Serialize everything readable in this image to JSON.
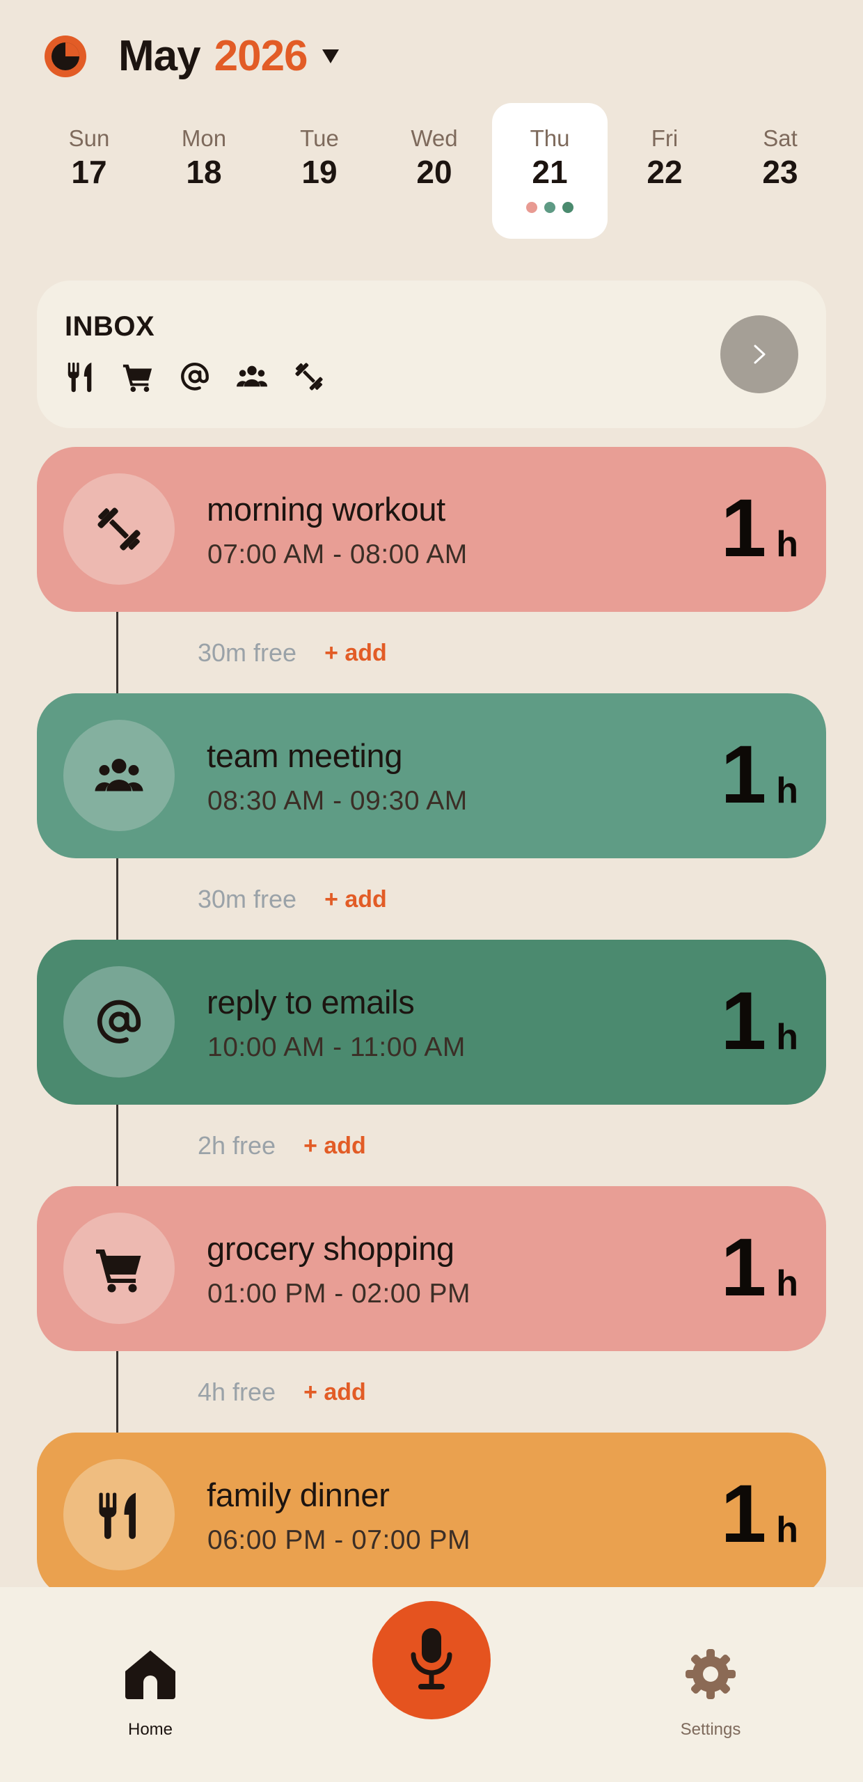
{
  "header": {
    "logo_icon": "pie-clock-logo",
    "month": "May",
    "year": "2026",
    "month_picker_icon": "caret-down-icon"
  },
  "week": [
    {
      "name": "Sun",
      "num": "17",
      "selected": false
    },
    {
      "name": "Mon",
      "num": "18",
      "selected": false
    },
    {
      "name": "Tue",
      "num": "19",
      "selected": false
    },
    {
      "name": "Wed",
      "num": "20",
      "selected": false
    },
    {
      "name": "Thu",
      "num": "21",
      "selected": true,
      "dot_colors": [
        "#e89a92",
        "#5e9a84",
        "#4a8a6e"
      ]
    },
    {
      "name": "Fri",
      "num": "22",
      "selected": false
    },
    {
      "name": "Sat",
      "num": "23",
      "selected": false
    }
  ],
  "inbox": {
    "title": "INBOX",
    "icons": [
      "fork-knife-icon",
      "cart-icon",
      "at-icon",
      "people-icon",
      "dumbbell-icon"
    ],
    "open_icon": "chevron-right-icon"
  },
  "events": [
    {
      "title": "morning workout",
      "time": "07:00 AM - 08:00 AM",
      "duration": "1",
      "unit": "h",
      "icon": "dumbbell-icon",
      "color": "#e89e95",
      "circle": "#edb9b1"
    },
    {
      "title": "team meeting",
      "time": "08:30 AM - 09:30 AM",
      "duration": "1",
      "unit": "h",
      "icon": "people-icon",
      "color": "#5f9c85",
      "circle": "#84b09f"
    },
    {
      "title": "reply to emails",
      "time": "10:00 AM - 11:00 AM",
      "duration": "1",
      "unit": "h",
      "icon": "at-icon",
      "color": "#4b8a6f",
      "circle": "#78a695"
    },
    {
      "title": "grocery shopping",
      "time": "01:00 PM - 02:00 PM",
      "duration": "1",
      "unit": "h",
      "icon": "cart-icon",
      "color": "#e89e95",
      "circle": "#edb9b1"
    },
    {
      "title": "family dinner",
      "time": "06:00 PM - 07:00 PM",
      "duration": "1",
      "unit": "h",
      "icon": "fork-knife-icon",
      "color": "#eaa14f",
      "circle": "#efbd80"
    }
  ],
  "gaps": [
    {
      "free": "30m free",
      "add": "+ add"
    },
    {
      "free": "30m free",
      "add": "+ add"
    },
    {
      "free": "2h free",
      "add": "+ add"
    },
    {
      "free": "4h free",
      "add": "+ add"
    }
  ],
  "nav": {
    "home_label": "Home",
    "home_icon": "home-icon",
    "mic_icon": "microphone-icon",
    "settings_label": "Settings",
    "settings_icon": "gear-icon"
  },
  "colors": {
    "accent": "#e25c26",
    "background": "#efe6da"
  }
}
